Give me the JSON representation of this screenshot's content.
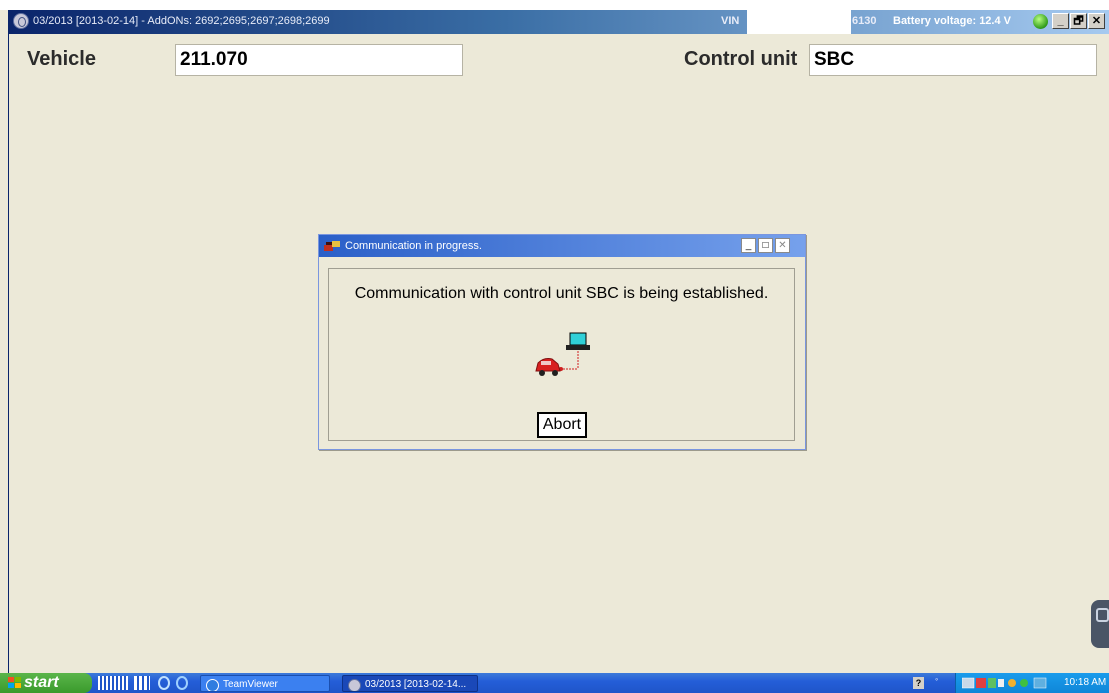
{
  "app_window": {
    "title": "03/2013 [2013-02-14] - AddONs: 2692;2695;2697;2698;2699",
    "vin_label": "VIN",
    "vin_tail": "6130",
    "battery_voltage": "Battery voltage: 12.4 V",
    "controls": {
      "minimize": "_",
      "restore": "🗗",
      "close": "✕"
    }
  },
  "header": {
    "vehicle_label": "Vehicle",
    "vehicle_value": "211.070",
    "control_unit_label": "Control unit",
    "control_unit_value": "SBC"
  },
  "dialog": {
    "title": "Communication in progress.",
    "message": "Communication with control unit SBC is being established.",
    "abort_label": "Abort",
    "controls": {
      "minimize": "_",
      "maximize": "□",
      "close": "✕"
    }
  },
  "taskbar": {
    "start_label": "start",
    "buttons": [
      {
        "label": "TeamViewer"
      },
      {
        "label": "03/2013 [2013-02-14..."
      }
    ],
    "clock": "10:18 AM"
  },
  "colors": {
    "desktop_bg": "#ece9d8",
    "titlebar_start": "#0a246a",
    "dialog_title": "#2a5fc8",
    "taskbar": "#245ed8",
    "start_button": "#3a9a2c",
    "tray": "#0f86d8"
  }
}
